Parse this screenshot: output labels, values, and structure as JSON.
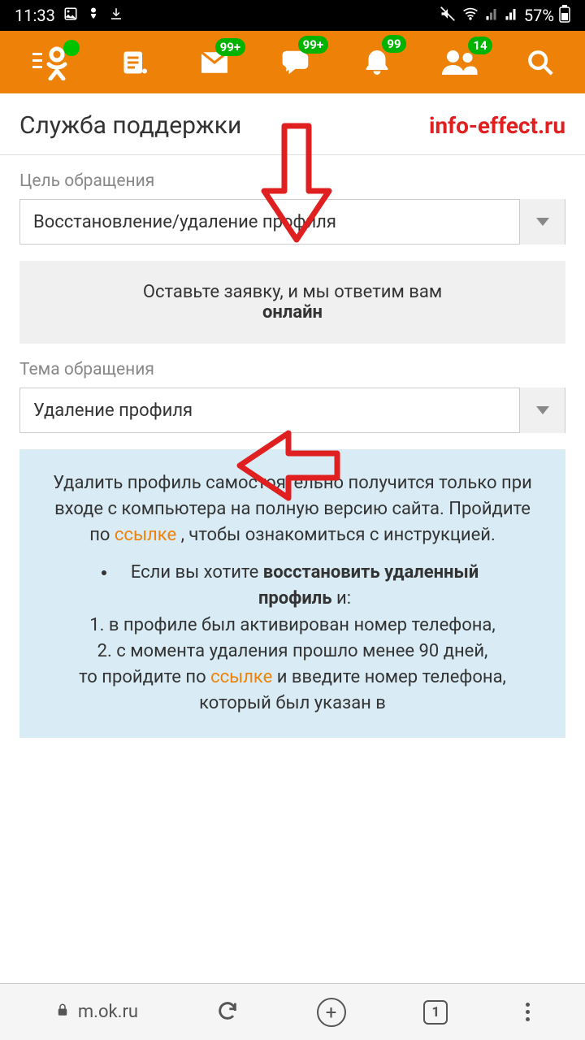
{
  "status": {
    "time": "11:33",
    "battery": "57%"
  },
  "header": {
    "badges": {
      "messages": "99+",
      "discussions": "99+",
      "notifications": "99",
      "friends": "14"
    }
  },
  "title": "Служба поддержки",
  "watermark": "info-effect.ru",
  "purpose": {
    "label": "Цель обращения",
    "value": "Восстановление/удаление профиля"
  },
  "notice": {
    "line1": "Оставьте заявку, и мы ответим вам",
    "line2": "онлайн"
  },
  "topic": {
    "label": "Тема обращения",
    "value": "Удаление профиля"
  },
  "info": {
    "p1a": "Удалить профиль самостоятельно получится только при входе с компьютера на полную версию сайта. Пройдите по ",
    "link1": "ссылке",
    "p1b": " , чтобы ознакомиться с инструкцией.",
    "bullet_a": "Если вы хотите ",
    "bullet_b": "восстановить удаленный профиль",
    "bullet_c": " и:",
    "n1": "1. в профиле был активирован номер телефона,",
    "n2": "2. с момента удаления прошло менее 90 дней,",
    "p2a": "то пройдите по ",
    "link2": "ссылке",
    "p2b": " и введите номер телефона, который был указан в"
  },
  "browser": {
    "url": "m.ok.ru",
    "tabs": "1"
  }
}
